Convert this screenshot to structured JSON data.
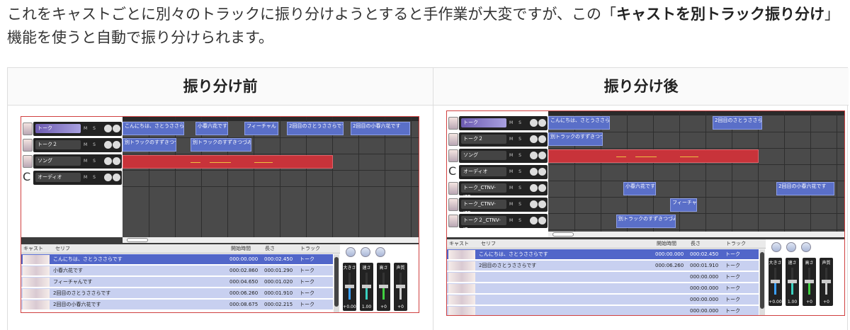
{
  "intro": {
    "text1": "これをキャストごとに別々のトラックに振り分けようとすると手作業が大変ですが、この「",
    "bold": "キャストを別トラック振り分け",
    "text2": "」機能を使うと自動で振り分けられます。"
  },
  "before": {
    "heading": "振り分け前",
    "tracks": [
      {
        "name": "トーク",
        "selected": true,
        "buttons": "M S"
      },
      {
        "name": "トーク２",
        "selected": false,
        "buttons": "M S"
      },
      {
        "name": "ソング",
        "selected": false,
        "buttons": "M S"
      },
      {
        "name": "オーディオ",
        "selected": false,
        "buttons": "M S"
      }
    ],
    "clips": [
      "こんにちは、さとうささらです",
      "小春六花です",
      "フィーチャん",
      "2回目のさとうささらです",
      "2回目の小春六花です",
      "別トラックのすずきつづみです",
      "別トラックのすずきつづみよ"
    ],
    "table": {
      "headers": [
        "キャスト",
        "セリフ",
        "開始時間",
        "長さ",
        "トラック"
      ],
      "rows": [
        {
          "line": "こんにちは、さとうささらです",
          "start": "000:00.000",
          "length": "000:02.450",
          "track": "トーク"
        },
        {
          "line": "小春六花です",
          "start": "000:02.860",
          "length": "000:01.290",
          "track": "トーク"
        },
        {
          "line": "フィーチャんです",
          "start": "000:04.650",
          "length": "000:01.020",
          "track": "トーク"
        },
        {
          "line": "2回目のさとうささらです",
          "start": "000:06.260",
          "length": "000:01.910",
          "track": "トーク"
        },
        {
          "line": "2回目の小春六花です",
          "start": "000:08.675",
          "length": "000:02.215",
          "track": "トーク"
        }
      ]
    },
    "mixer": {
      "faders": [
        {
          "label": "大きさ",
          "value": "+0.00",
          "level": 0.5,
          "color": "#3aa0ff"
        },
        {
          "label": "速さ",
          "value": "1.00",
          "level": 0.5,
          "color": "#3ad0c0"
        },
        {
          "label": "高さ",
          "value": "+0",
          "level": 0.5,
          "color": "#40d040"
        },
        {
          "label": "声質",
          "value": "+0",
          "level": 0.5,
          "color": "#cccccc"
        }
      ]
    }
  },
  "after": {
    "heading": "振り分け後",
    "tracks": [
      {
        "name": "トーク",
        "selected": true,
        "buttons": "M S"
      },
      {
        "name": "トーク２",
        "selected": false,
        "buttons": "M S"
      },
      {
        "name": "ソング",
        "selected": false,
        "buttons": "M S"
      },
      {
        "name": "オーディオ",
        "selected": false,
        "buttons": "M S"
      },
      {
        "name": "トーク_CTNV-JPF-...",
        "selected": false,
        "buttons": "M S"
      },
      {
        "name": "トーク_CTNV-JPF...",
        "selected": false,
        "buttons": "M S"
      },
      {
        "name": "トーク２_CTNV-JP-...",
        "selected": false,
        "buttons": "M S"
      }
    ],
    "clips": [
      "こんにちは、さとうささらです",
      "2回目のさとうささらです",
      "別トラックのすずきつづみです",
      "小春六花です",
      "2回目の小春六花です",
      "フィーチャん",
      "別トラックのすずきつづみよ"
    ],
    "table": {
      "headers": [
        "キャスト",
        "セリフ",
        "開始時間",
        "長さ",
        "トラック"
      ],
      "rows": [
        {
          "line": "こんにちは、さとうささらです",
          "start": "000:00.000",
          "length": "000:02.450",
          "track": "トーク"
        },
        {
          "line": "2回目のさとうささらです",
          "start": "000:06.260",
          "length": "000:01.910",
          "track": "トーク"
        },
        {
          "line": "",
          "start": "",
          "length": "000:00.000",
          "track": "トーク"
        },
        {
          "line": "",
          "start": "",
          "length": "000:00.000",
          "track": "トーク"
        },
        {
          "line": "",
          "start": "",
          "length": "000:00.000",
          "track": "トーク"
        },
        {
          "line": "",
          "start": "",
          "length": "000:00.000",
          "track": "トーク"
        }
      ]
    },
    "mixer": {
      "faders": [
        {
          "label": "大きさ",
          "value": "+0.00",
          "level": 0.5,
          "color": "#3aa0ff"
        },
        {
          "label": "速さ",
          "value": "1.00",
          "level": 0.5,
          "color": "#3ad0c0"
        },
        {
          "label": "高さ",
          "value": "+0",
          "level": 0.5,
          "color": "#40d040"
        },
        {
          "label": "声質",
          "value": "+0",
          "level": 0.5,
          "color": "#cccccc"
        }
      ]
    }
  }
}
